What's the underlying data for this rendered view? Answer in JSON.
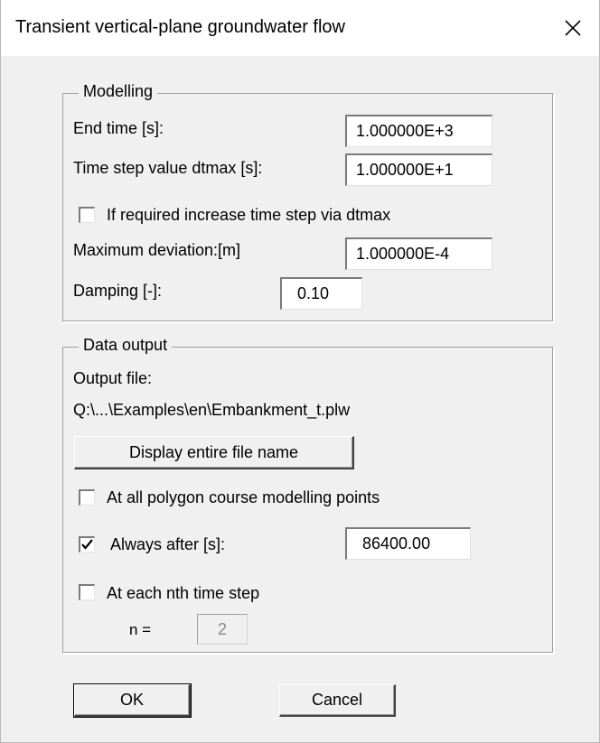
{
  "window": {
    "title": "Transient vertical-plane groundwater flow",
    "close_icon": "close-icon"
  },
  "modelling": {
    "group_title": "Modelling",
    "end_time_label": "End time [s]:",
    "end_time_value": "1.000000E+3",
    "time_step_label": "Time step value dtmax [s]:",
    "time_step_value": "1.000000E+1",
    "increase_step_label": "If required increase time step via dtmax",
    "increase_step_checked": false,
    "max_deviation_label": "Maximum deviation:[m]",
    "max_deviation_value": "1.000000E-4",
    "damping_label": "Damping [-]:",
    "damping_value": "0.10"
  },
  "data_output": {
    "group_title": "Data output",
    "output_file_label": "Output file:",
    "output_file_path": "Q:\\...\\Examples\\en\\Embankment_t.plw",
    "display_button_label": "Display entire file name",
    "polygon_points_label": "At all polygon course modelling points",
    "polygon_points_checked": false,
    "always_after_label": "Always after [s]:",
    "always_after_checked": true,
    "always_after_value": "86400.00",
    "nth_step_label": "At each nth time step",
    "nth_step_checked": false,
    "n_label": "n =",
    "n_value": "2"
  },
  "buttons": {
    "ok_label": "OK",
    "cancel_label": "Cancel"
  }
}
